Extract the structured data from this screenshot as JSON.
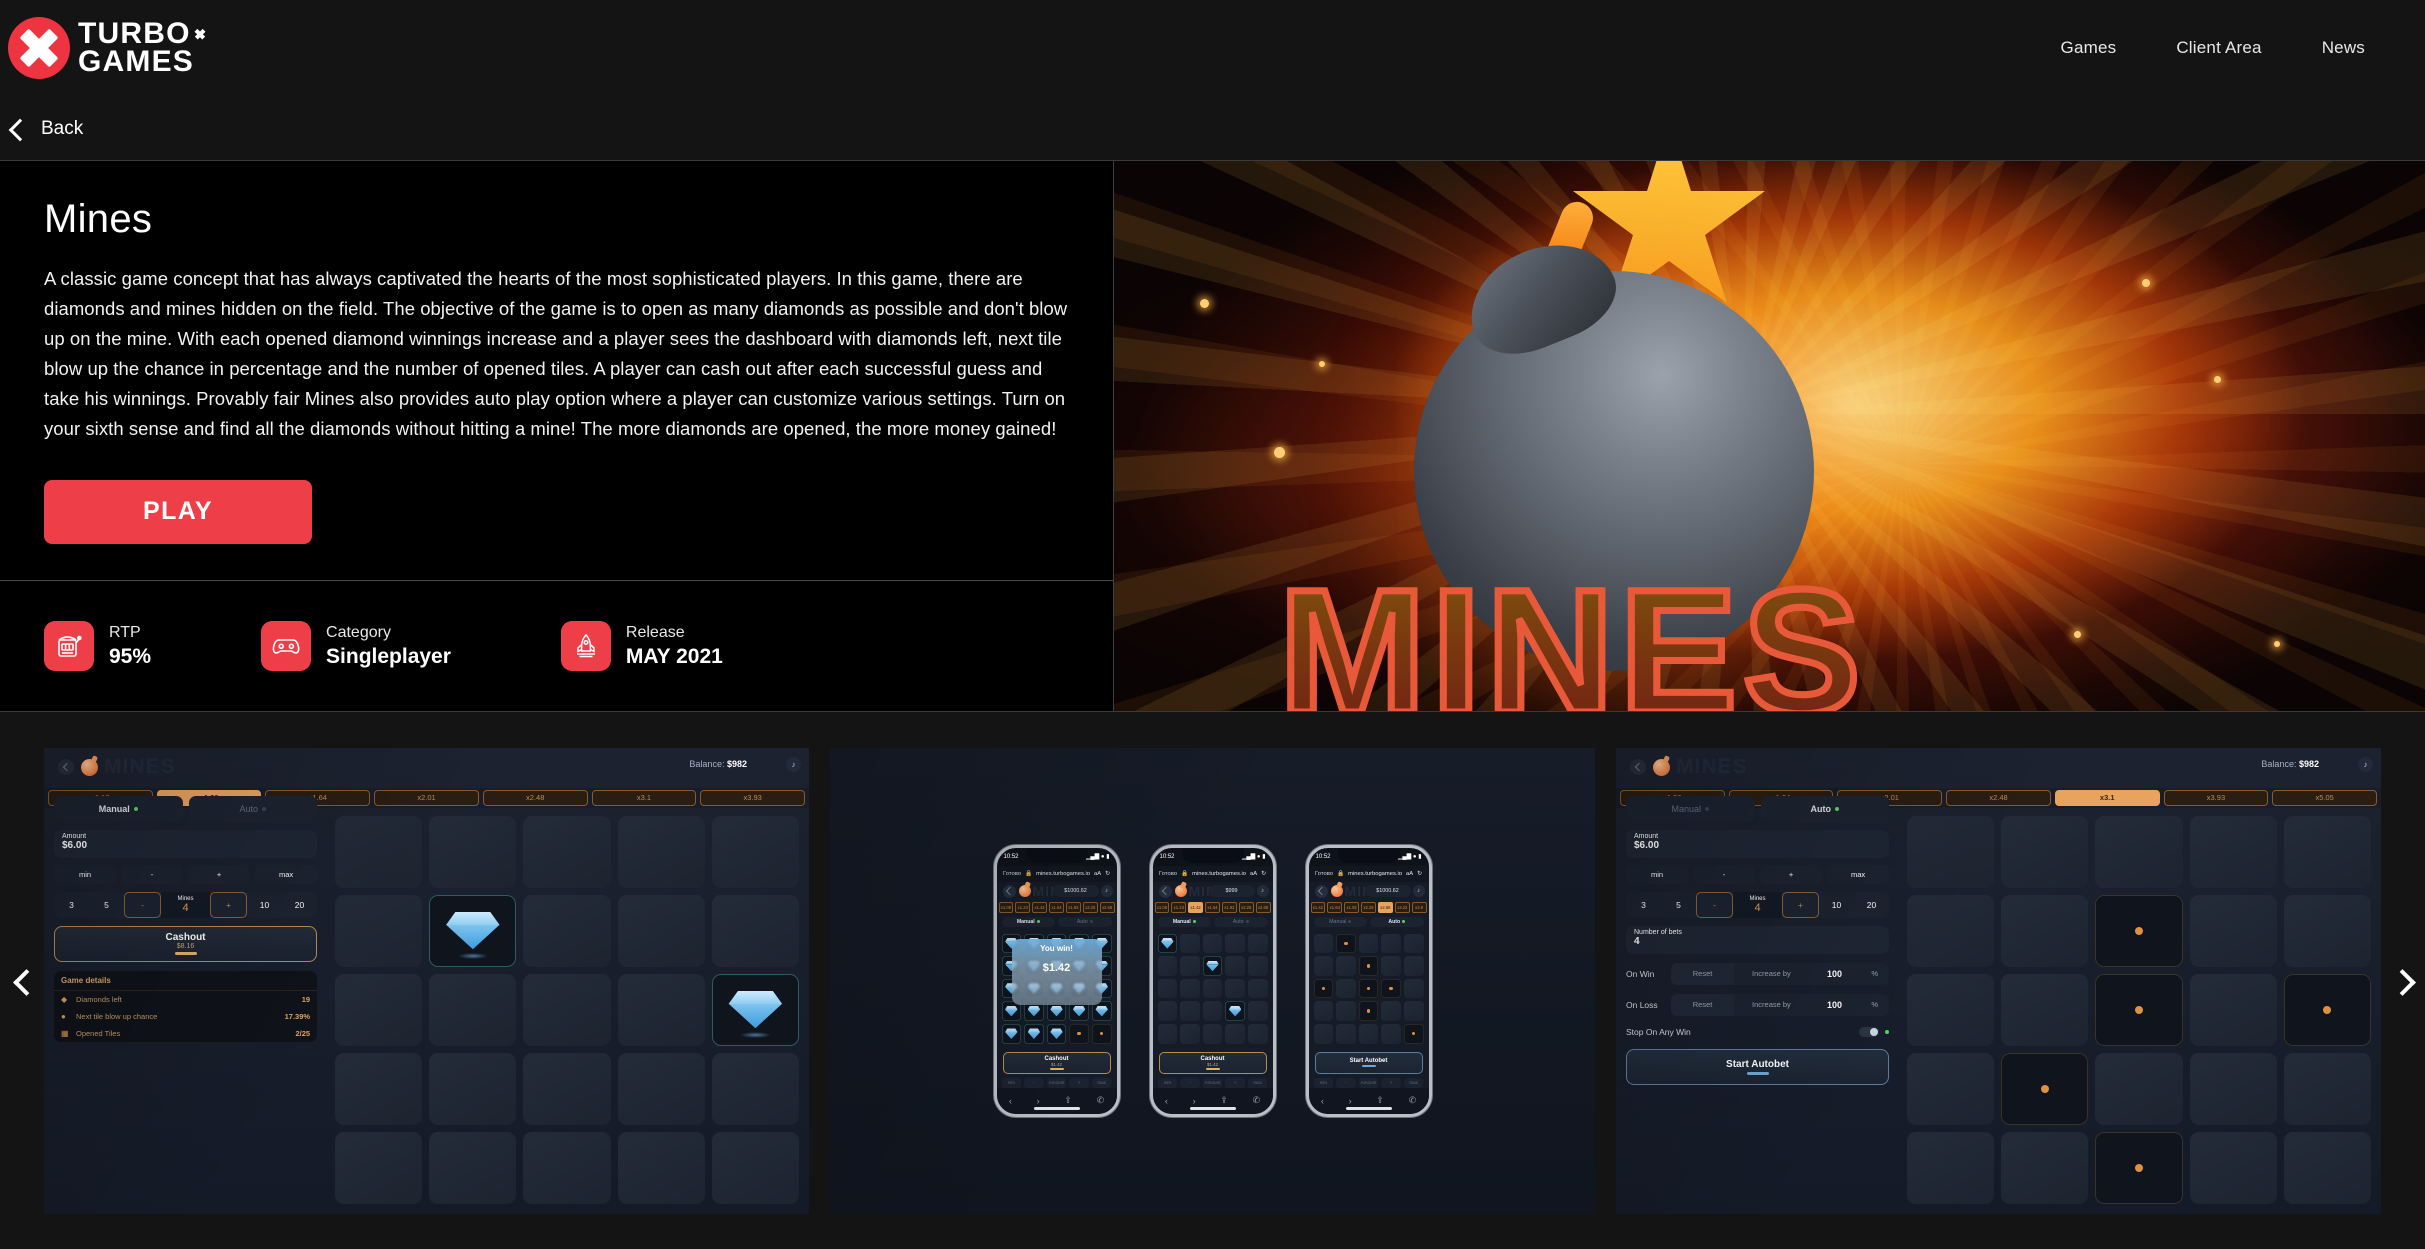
{
  "header": {
    "logo": {
      "line1": "TURBO",
      "line2": "GAMES",
      "mark": "x-logo-icon"
    },
    "nav": [
      {
        "label": "Games"
      },
      {
        "label": "Client Area"
      },
      {
        "label": "News"
      }
    ]
  },
  "backbar": {
    "label": "Back",
    "icon": "chevron-left-icon"
  },
  "hero": {
    "title": "Mines",
    "description": "A classic game concept that has always captivated the hearts of the most sophisticated players. In this game, there are diamonds and mines hidden on the field. The objective of the game is to open as many diamonds as possible and don't blow up on the mine. With each opened diamond winnings increase and a player sees the dashboard with diamonds left, next tile blow up the chance in percentage and the number of opened tiles. A player can cash out after each successful guess and take his winnings. Provably fair Mines also provides auto play option where a player can customize various settings. Turn on your sixth sense and find all the diamonds without hitting a mine! The more diamonds are opened, the more money gained!",
    "play_label": "PLAY",
    "banner_word": "MINES",
    "meta": [
      {
        "icon": "slot-machine-icon",
        "label": "RTP",
        "value": "95%"
      },
      {
        "icon": "gamepad-icon",
        "label": "Category",
        "value": "Singleplayer"
      },
      {
        "icon": "rocket-icon",
        "label": "Release",
        "value": "MAY 2021"
      }
    ]
  },
  "carousel": {
    "prev_icon": "chevron-left-icon",
    "next_icon": "chevron-right-icon",
    "slides": [
      {
        "name": "mines-manual-desktop",
        "app": {
          "title": "MINES",
          "back_icon": "chevron-left-icon",
          "bomb_icon": "bomb-icon",
          "balance_label": "Balance:",
          "balance_value": "$982",
          "sound_icon": "sound-on-icon",
          "multipliers": [
            "x1.13",
            "x1.36",
            "x1.64",
            "x2.01",
            "x2.48",
            "x3.1",
            "x3.93"
          ],
          "multiplier_active_index": 1,
          "tabs": [
            {
              "label": "Manual",
              "active": true
            },
            {
              "label": "Auto",
              "active": false
            }
          ],
          "amount_label": "Amount",
          "amount_value": "$6.00",
          "amount_buttons": [
            "min",
            "-",
            "+",
            "max"
          ],
          "mines_row": [
            "3",
            "5",
            "-",
            "+",
            "10",
            "20"
          ],
          "mines_label": "Mines",
          "mines_value": "4",
          "action": {
            "label": "Cashout",
            "sub": "$8.16"
          },
          "details_title": "Game details",
          "details": [
            {
              "icon": "diamond-icon",
              "label": "Diamonds left",
              "value": "19"
            },
            {
              "icon": "bomb-icon",
              "label": "Next tile blow up chance",
              "value": "17.39%"
            },
            {
              "icon": "tiles-icon",
              "label": "Opened Tiles",
              "value": "2/25"
            }
          ],
          "gems": [
            6,
            14
          ]
        }
      },
      {
        "name": "mines-mobile-phones",
        "phones": [
          {
            "time": "10:52",
            "browser_done": "Готово",
            "url": "mines.turbogames.io",
            "lock_icon": "lock-icon",
            "reload_icon": "reload-icon",
            "text_size_icon": "aA",
            "title": "MINES",
            "balance_value": "$1000.62",
            "multipliers": [
              "x1.08",
              "x1.23",
              "x1.42",
              "x1.64",
              "x1.92",
              "x2.25",
              "x2.68"
            ],
            "multiplier_active_index": -1,
            "tabs": [
              {
                "label": "Manual",
                "active": true
              },
              {
                "label": "Auto",
                "active": false
              }
            ],
            "popup": {
              "title": "You win!",
              "value": "$1.42"
            },
            "action": {
              "label": "Cashout",
              "sub": "$1.42"
            },
            "footer": [
              "min",
              "-",
              "Amount",
              "+",
              "max"
            ],
            "all_gems": true
          },
          {
            "time": "10:52",
            "browser_done": "Готово",
            "url": "mines.turbogames.io",
            "lock_icon": "lock-icon",
            "reload_icon": "reload-icon",
            "text_size_icon": "aA",
            "title": "MINES",
            "balance_value": "$999",
            "multipliers": [
              "x1.08",
              "x1.23",
              "x1.42",
              "x1.64",
              "x1.92",
              "x2.25",
              "x2.68"
            ],
            "multiplier_active_index": 2,
            "tabs": [
              {
                "label": "Manual",
                "active": true
              },
              {
                "label": "Auto",
                "active": false
              }
            ],
            "action": {
              "label": "Cashout",
              "sub": "$1.42"
            },
            "footer": [
              "min",
              "-",
              "Amount",
              "+",
              "max"
            ],
            "gems": [
              0,
              7,
              18
            ]
          },
          {
            "time": "10:52",
            "browser_done": "Готово",
            "url": "mines.turbogames.io",
            "lock_icon": "lock-icon",
            "reload_icon": "reload-icon",
            "text_size_icon": "aA",
            "title": "MINES",
            "balance_value": "$1000.62",
            "multipliers": [
              "x1.42",
              "x1.64",
              "x1.92",
              "x2.25",
              "x2.68",
              "x3.22",
              "x3.9"
            ],
            "multiplier_active_index": 4,
            "tabs": [
              {
                "label": "Manual",
                "active": false
              },
              {
                "label": "Auto",
                "active": true
              }
            ],
            "action": {
              "label": "Start Autobet",
              "sub": ""
            },
            "footer": [
              "min",
              "-",
              "Amount",
              "+",
              "max"
            ],
            "mines": [
              1,
              7,
              10,
              12,
              13,
              17,
              24
            ]
          }
        ]
      },
      {
        "name": "mines-auto-desktop",
        "app": {
          "title": "MINES",
          "back_icon": "chevron-left-icon",
          "bomb_icon": "bomb-icon",
          "balance_label": "Balance:",
          "balance_value": "$982",
          "sound_icon": "sound-on-icon",
          "multipliers": [
            "x1.36",
            "x1.64",
            "x2.01",
            "x2.48",
            "x3.1",
            "x3.93",
            "x5.05"
          ],
          "multiplier_active_index": 4,
          "tabs": [
            {
              "label": "Manual",
              "active": false
            },
            {
              "label": "Auto",
              "active": true
            }
          ],
          "amount_label": "Amount",
          "amount_value": "$6.00",
          "amount_buttons": [
            "min",
            "-",
            "+",
            "max"
          ],
          "mines_row": [
            "3",
            "5",
            "-",
            "+",
            "10",
            "20"
          ],
          "mines_label": "Mines",
          "mines_value": "4",
          "bets_label": "Number of bets",
          "bets_value": "4",
          "on_win": {
            "label": "On Win",
            "reset": "Reset",
            "increase": "Increase by",
            "value": "100",
            "unit": "%"
          },
          "on_loss": {
            "label": "On Loss",
            "reset": "Reset",
            "increase": "Increase by",
            "value": "100",
            "unit": "%"
          },
          "stop_label": "Stop On Any Win",
          "action": {
            "label": "Start Autobet",
            "sub": ""
          },
          "mines": [
            7,
            12,
            16,
            22
          ]
        }
      }
    ]
  },
  "colors": {
    "brand_red": "#ee3f48",
    "page_bg": "#141414",
    "panel_bg": "#1c2330",
    "accent_orange": "#e8a35f",
    "accent_blue": "#6fa8d6"
  }
}
